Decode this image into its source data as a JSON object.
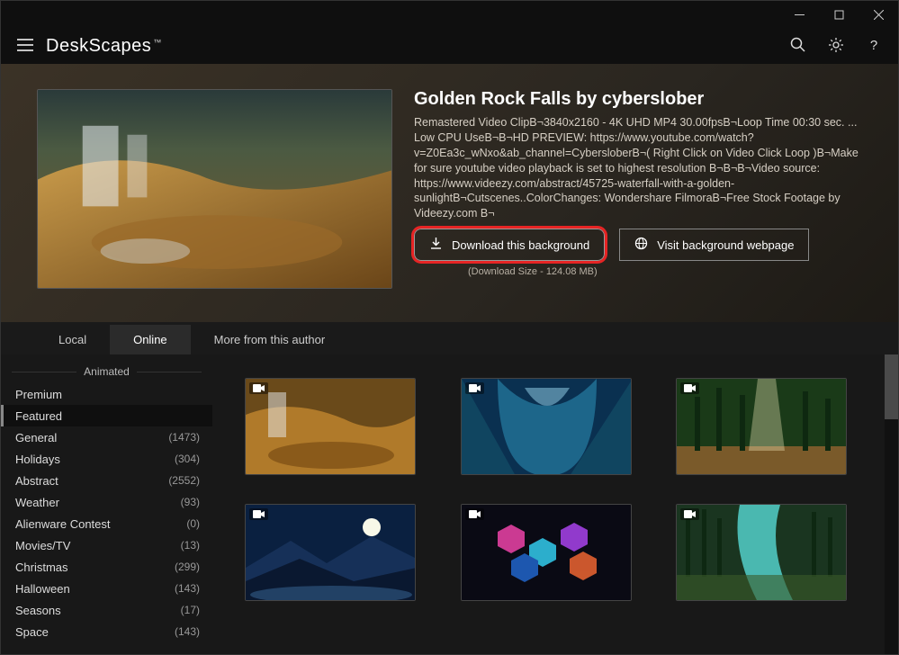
{
  "app_title": "DeskScapes",
  "hero": {
    "title": "Golden Rock Falls by cyberslober",
    "description": "Remastered Video ClipВ¬3840x2160 - 4K UHD MP4 30.00fpsВ¬Loop Time 00:30 sec. ... Low CPU UseВ¬В¬HD PREVIEW: https://www.youtube.com/watch?v=Z0Ea3c_wNxo&ab_channel=CybersloberВ¬( Right Click on Video Click Loop )В¬Make for sure youtube video playback is set to highest resolution В¬В¬В¬Video source: https://www.videezy.com/abstract/45725-waterfall-with-a-golden-sunlightВ¬Cutscenes..ColorChanges: Wondershare FilmoraВ¬Free Stock Footage by Videezy.com В¬",
    "download_label": "Download this background",
    "visit_label": "Visit background webpage",
    "download_size": "(Download Size - 124.08 MB)"
  },
  "tabs": [
    {
      "label": "Local",
      "active": false
    },
    {
      "label": "Online",
      "active": true
    },
    {
      "label": "More from this author",
      "active": false
    }
  ],
  "sidebar": {
    "section": "Animated",
    "categories": [
      {
        "name": "Premium",
        "count": null,
        "active": false
      },
      {
        "name": "Featured",
        "count": null,
        "active": true
      },
      {
        "name": "General",
        "count": "(1473)",
        "active": false
      },
      {
        "name": "Holidays",
        "count": "(304)",
        "active": false
      },
      {
        "name": "Abstract",
        "count": "(2552)",
        "active": false
      },
      {
        "name": "Weather",
        "count": "(93)",
        "active": false
      },
      {
        "name": "Alienware Contest",
        "count": "(0)",
        "active": false
      },
      {
        "name": "Movies/TV",
        "count": "(13)",
        "active": false
      },
      {
        "name": "Christmas",
        "count": "(299)",
        "active": false
      },
      {
        "name": "Halloween",
        "count": "(143)",
        "active": false
      },
      {
        "name": "Seasons",
        "count": "(17)",
        "active": false
      },
      {
        "name": "Space",
        "count": "(143)",
        "active": false
      }
    ]
  },
  "gallery": [
    {
      "name": "waterfall-golden",
      "theme": "golden"
    },
    {
      "name": "ice-cave",
      "theme": "ice"
    },
    {
      "name": "forest-rays",
      "theme": "forest"
    },
    {
      "name": "moon-mountains",
      "theme": "night"
    },
    {
      "name": "hexagons",
      "theme": "hex"
    },
    {
      "name": "river-green",
      "theme": "river"
    }
  ]
}
